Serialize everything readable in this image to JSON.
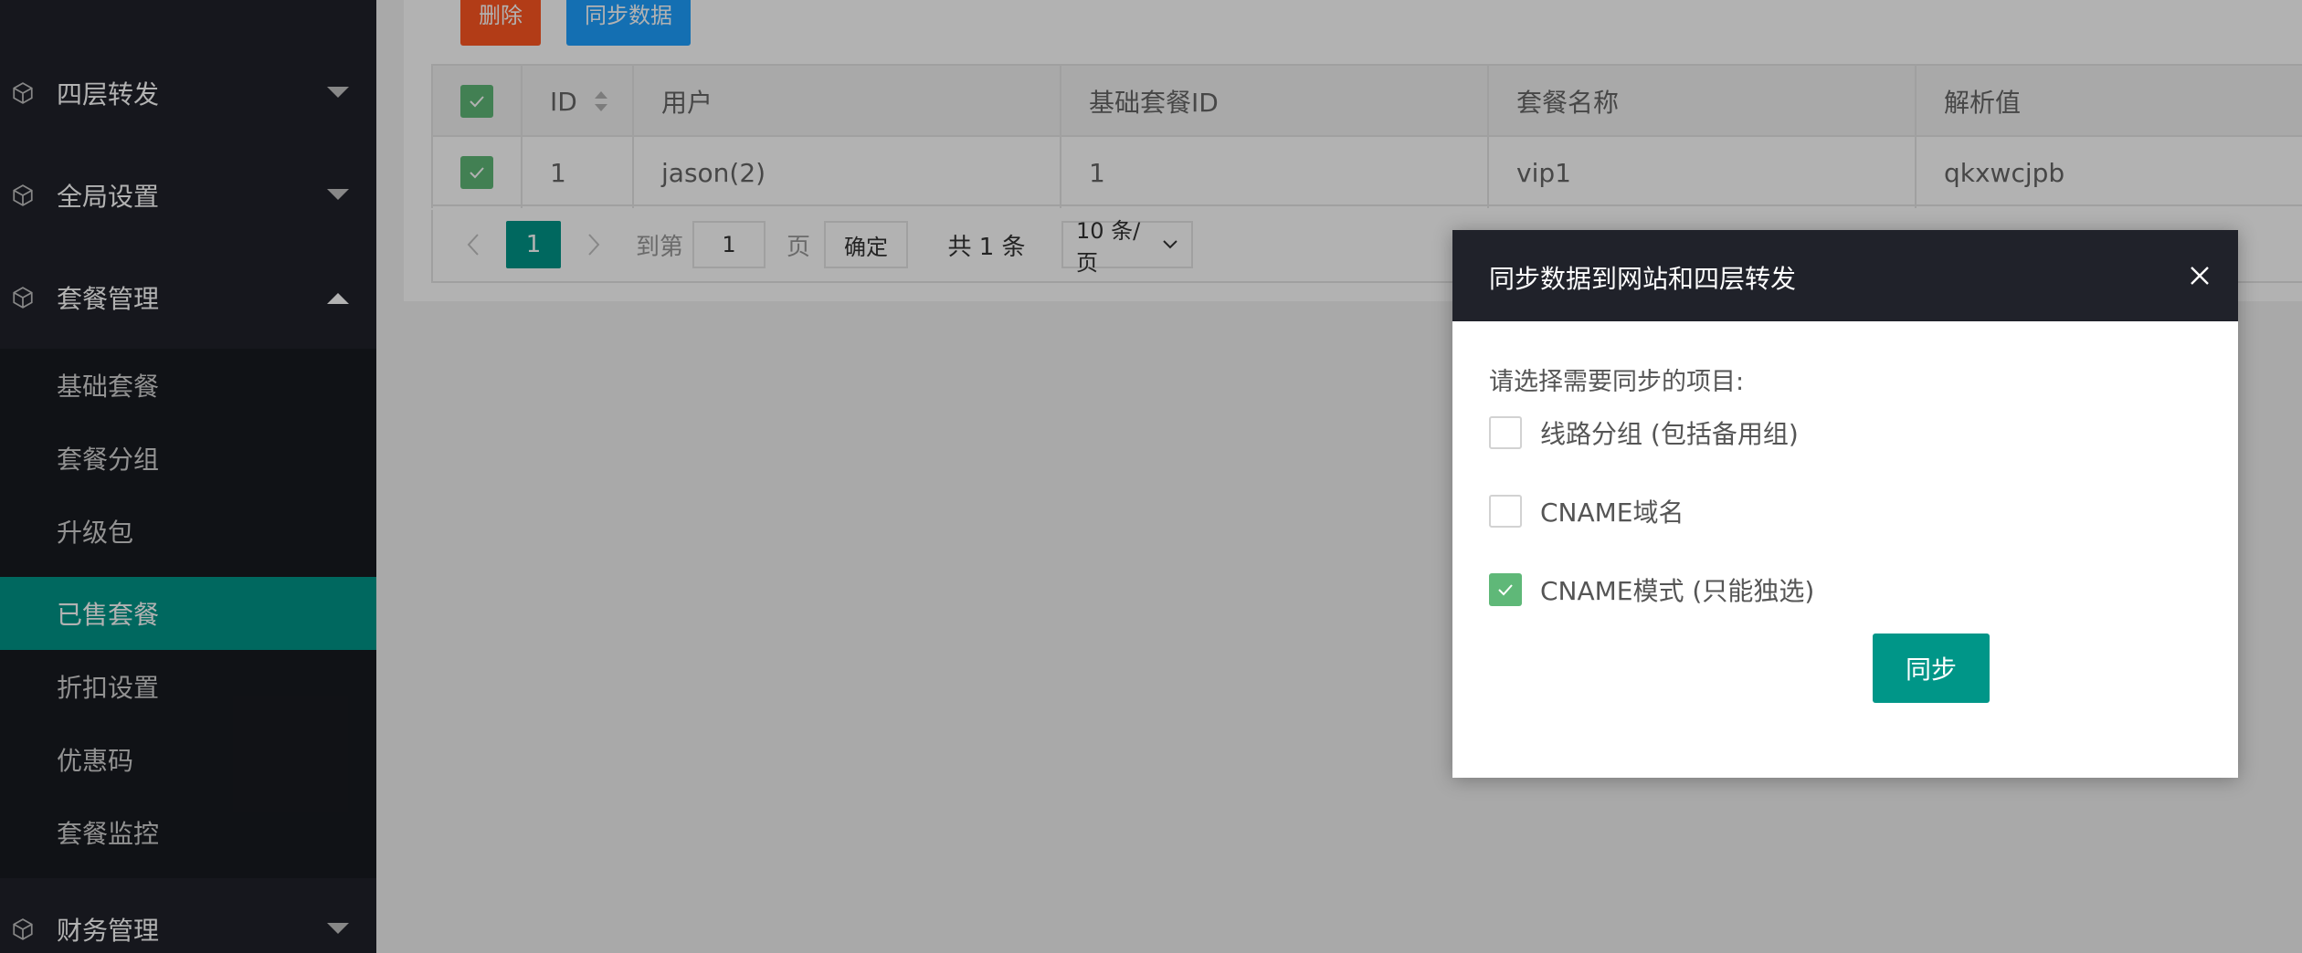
{
  "sidebar": {
    "top_items": [
      {
        "label": "四层转发",
        "icon": "cube-icon",
        "arrow": "chevron-down"
      },
      {
        "label": "全局设置",
        "icon": "cube-icon",
        "arrow": "chevron-down"
      },
      {
        "label": "套餐管理",
        "icon": "cube-icon",
        "arrow": "chevron-up"
      }
    ],
    "sub_items": [
      {
        "label": "基础套餐"
      },
      {
        "label": "套餐分组"
      },
      {
        "label": "升级包"
      },
      {
        "label": "已售套餐",
        "active": true
      },
      {
        "label": "折扣设置"
      },
      {
        "label": "优惠码"
      },
      {
        "label": "套餐监控"
      }
    ],
    "bottom_item": {
      "label": "财务管理",
      "icon": "cube-icon",
      "arrow": "chevron-down"
    }
  },
  "toolbar": {
    "delete_label": "删除",
    "sync_label": "同步数据"
  },
  "table": {
    "columns": [
      "ID",
      "用户",
      "基础套餐ID",
      "套餐名称",
      "解析值"
    ],
    "rows": [
      {
        "checked": true,
        "cells": [
          "1",
          "jason(2)",
          "1",
          "vip1",
          "qkxwcjpb"
        ]
      }
    ],
    "header_checked": true
  },
  "pager": {
    "current": "1",
    "goto_label": "到第",
    "input_value": "1",
    "page_label": "页",
    "ok_label": "确定",
    "total_label": "共 1 条",
    "size_label": "10 条/页"
  },
  "modal": {
    "title": "同步数据到网站和四层转发",
    "prompt": "请选择需要同步的项目:",
    "options": [
      {
        "label": "线路分组 (包括备用组)",
        "checked": false
      },
      {
        "label": "CNAME域名",
        "checked": false
      },
      {
        "label": "CNAME模式 (只能独选)",
        "checked": true
      }
    ],
    "submit_label": "同步"
  },
  "colors": {
    "sidebar_bg": "#20222a",
    "accent": "#009688",
    "danger": "#ff5722",
    "primary": "#1e9fff",
    "checkbox_on": "#5fb878"
  }
}
